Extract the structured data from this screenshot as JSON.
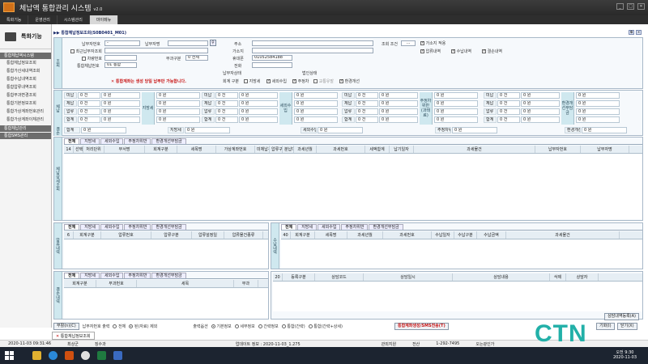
{
  "app": {
    "title": "체납액 통합관리 시스템",
    "version": "v2.0",
    "menus": [
      "특화기능",
      "운영관리",
      "시스템관리",
      "마이메뉴"
    ],
    "active_menu": 3
  },
  "sidebar": {
    "title": "특화기능",
    "groups": [
      {
        "label": "통합체납액시스템",
        "items": [
          "통합체납정보조회",
          "통합가산세내역조회",
          "통합수납내역조회",
          "통합압류내역조회",
          "통합부과변경조회",
          "통합기본정보조회",
          "통합가상계좌번호관리",
          "통합가상계좌이체관리"
        ]
      },
      {
        "label": "통합체납관리",
        "items": []
      },
      {
        "label": "통합SMS관리",
        "items": []
      }
    ]
  },
  "breadcrumb": "▶▶ 통합체납정보조회(S0B0401_M01)",
  "window_icons": [
    "⧉",
    "✕"
  ],
  "search": {
    "section_label": "조회",
    "taxpayer_no_label": "납부자번호",
    "taxpayer_no_value": "-",
    "taxpayer_name_label": "납부자명",
    "company_chk_label": "최근납부자조회",
    "vehicle_chk_label": "차량번호",
    "levy_label": "부과구분",
    "levy_value": "0 전체",
    "integ_label": "통합체납번호",
    "integ_value": "01 통합",
    "addr_label": "주소",
    "ga_label": "가소지",
    "phone_label": "휴대폰",
    "phone_value": "01052584188",
    "tel_label": "전화",
    "payer_status_label": "납부자상태",
    "cond_label": "조회 조건",
    "cond_btn": "...",
    "checks": [
      {
        "label": "가소지 적용",
        "on": true
      },
      {
        "label": "압류내역",
        "on": true
      },
      {
        "label": "수납내역",
        "on": true
      },
      {
        "label": "결손내역",
        "on": true
      }
    ],
    "warning": "✕ 통합계좌는 생성 당일 납부만 가능합니다.",
    "account_label": "회계 구분",
    "account_opts": [
      {
        "label": "지방세",
        "on": false
      },
      {
        "label": "세외수입",
        "on": true
      },
      {
        "label": "주정차",
        "on": true
      },
      {
        "label": "교통유발",
        "on": false
      },
      {
        "label": "환경개선",
        "on": true
      }
    ],
    "corp_label": "법인상태"
  },
  "summary": {
    "side_label": "체납",
    "side_label2": "결손",
    "groups": [
      "지방세",
      "세외수입",
      "주정차위반(과태료)",
      "환경개선부담금"
    ],
    "rows": [
      "미납",
      "체납",
      "압류",
      "합계"
    ],
    "zero": "0",
    "count_unit": "건",
    "won_unit": "원",
    "total_row": [
      "합계",
      "지방세",
      "세외수입",
      "주정차위반",
      "환경개선"
    ]
  },
  "grid1": {
    "side_label": "체납상세조회",
    "tabs": [
      "전체",
      "지방세",
      "세외수입",
      "주정차위반",
      "환경개선부담금"
    ],
    "count": "14",
    "headers": [
      "선택",
      "처리단위",
      "부서명",
      "회계구분",
      "세목명",
      "가상계좌번호",
      "미체납구분",
      "압류구분",
      "분납여부",
      "과세년월",
      "과세번호",
      "세액합계",
      "납기일자",
      "과세물건",
      "납부자번호",
      "납부자명"
    ]
  },
  "grid2": {
    "side_label": "압류내역",
    "tabs": [
      "전체",
      "지방세",
      "세외수입",
      "주정차위반",
      "환경개선부담금"
    ],
    "count": "6",
    "headers": [
      "회계구분",
      "압류번호",
      "압류구분",
      "압류설정일",
      "압류물건종류"
    ]
  },
  "grid3": {
    "side_label": "수납내역",
    "tabs": [
      "전체",
      "지방세",
      "세외수입",
      "주정차위반",
      "환경개선부담금"
    ],
    "count": "40",
    "headers": [
      "회계구분",
      "세목명",
      "과세년월",
      "과세번호",
      "수납일자",
      "수납구분",
      "수납금액",
      "과세물건"
    ]
  },
  "grid4": {
    "side_label": "결손내역",
    "tabs": [
      "전체",
      "지방세",
      "세외수입",
      "주정차위반",
      "환경개선부담금"
    ],
    "headers": [
      "회계구분",
      "부과번호",
      "세목",
      "부과"
    ]
  },
  "grid5": {
    "count": "20",
    "headers": [
      "등록구분",
      "상담코드",
      "상담일시",
      "상담내용",
      "삭제",
      "상담자"
    ],
    "btn": "상담내역등록(A)"
  },
  "footer": {
    "btn_save": "부활(n)(C)",
    "print_label": "납부자번호 출력",
    "print_opts": [
      {
        "label": "전체",
        "on": false
      },
      {
        "label": "된(자료) 제외",
        "on": true
      }
    ],
    "out_label": "출력옵션",
    "out_opts": [
      {
        "label": "기본정보",
        "on": true
      },
      {
        "label": "세부정보",
        "on": false
      },
      {
        "label": "간략정보",
        "on": false
      },
      {
        "label": "통합(간략)",
        "on": false
      },
      {
        "label": "통합(간략+상세)",
        "on": false
      }
    ],
    "btn_create": "통합계좌생성/SMS전송(T)",
    "btn_a": "기화(I)",
    "btn_close": "닫기(X)"
  },
  "doc_tab": "통합체납정보조회",
  "status": {
    "datetime": "2020-11-03 09:31:46",
    "user": "최상군",
    "dept": "징수과",
    "update": "업데이트 정보 : 2020-11-03_1.275",
    "right1": "관외지원",
    "right2": "전산",
    "tel": "1-292-7495",
    "office": "오는광인가"
  },
  "taskbar": {
    "time": "오전 9:30",
    "date": "2020-11-03"
  },
  "watermark": "CTN"
}
